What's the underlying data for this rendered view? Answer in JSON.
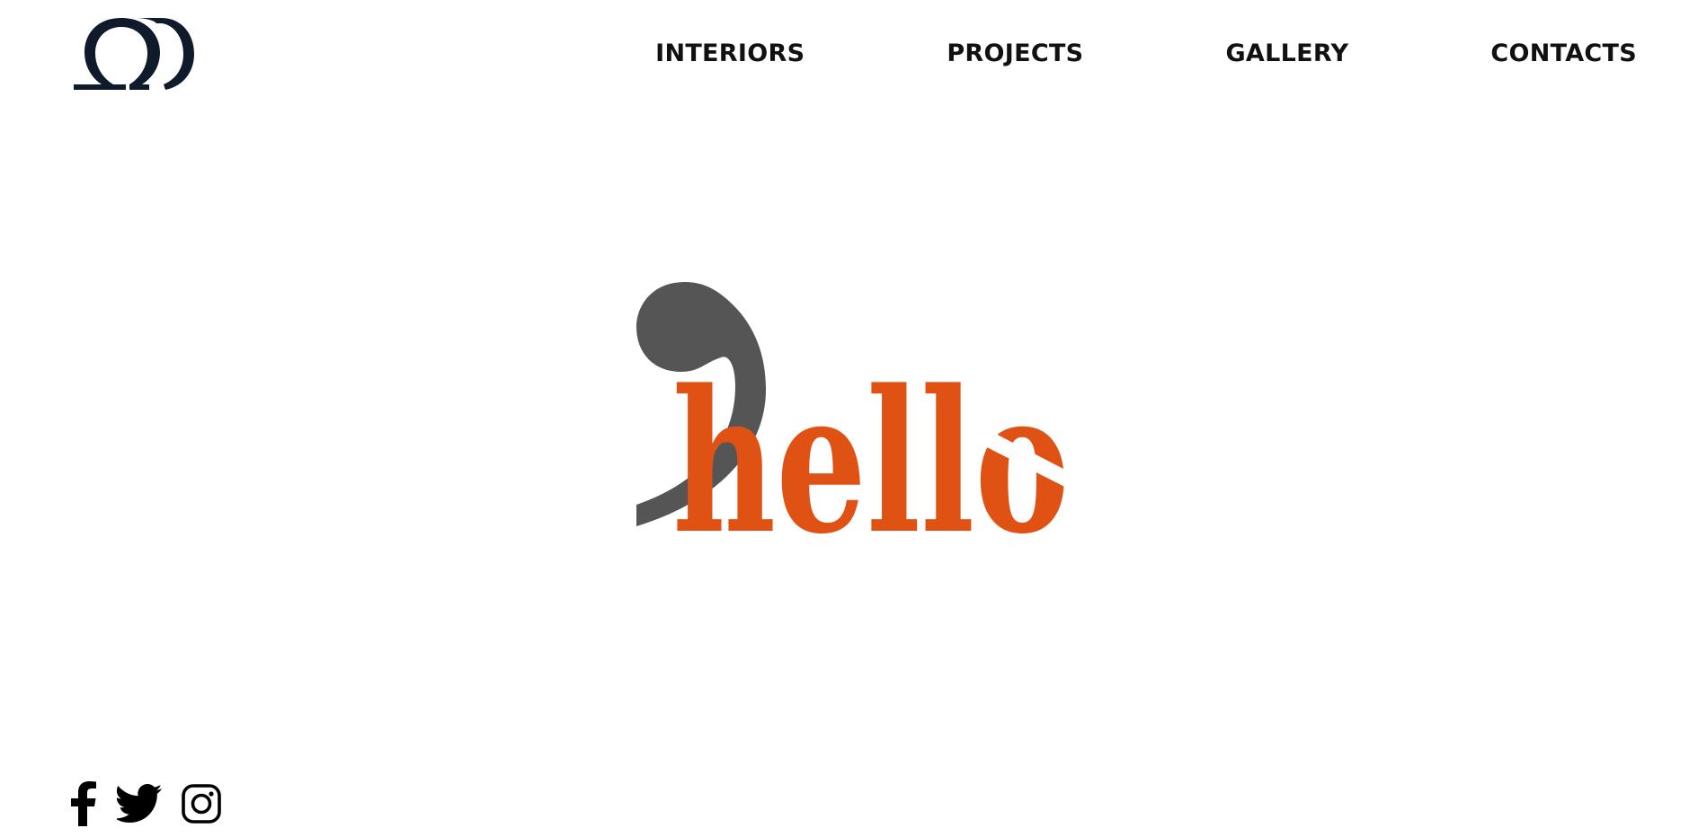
{
  "brand": {
    "logo_icon": "monogram-logo-icon",
    "logo_color": "#0f1a2b"
  },
  "nav": {
    "items": [
      {
        "label": "INTERIORS"
      },
      {
        "label": "PROJECTS"
      },
      {
        "label": "GALLERY"
      },
      {
        "label": "CONTACTS"
      }
    ],
    "text_color": "#111111"
  },
  "hero": {
    "word": "hello",
    "word_color": "#e05214",
    "comma_color": "#555555",
    "decoration_icon": "comma-quote-icon"
  },
  "social": {
    "icons": [
      "facebook-icon",
      "twitter-icon",
      "instagram-icon"
    ],
    "icon_color": "#000000"
  }
}
